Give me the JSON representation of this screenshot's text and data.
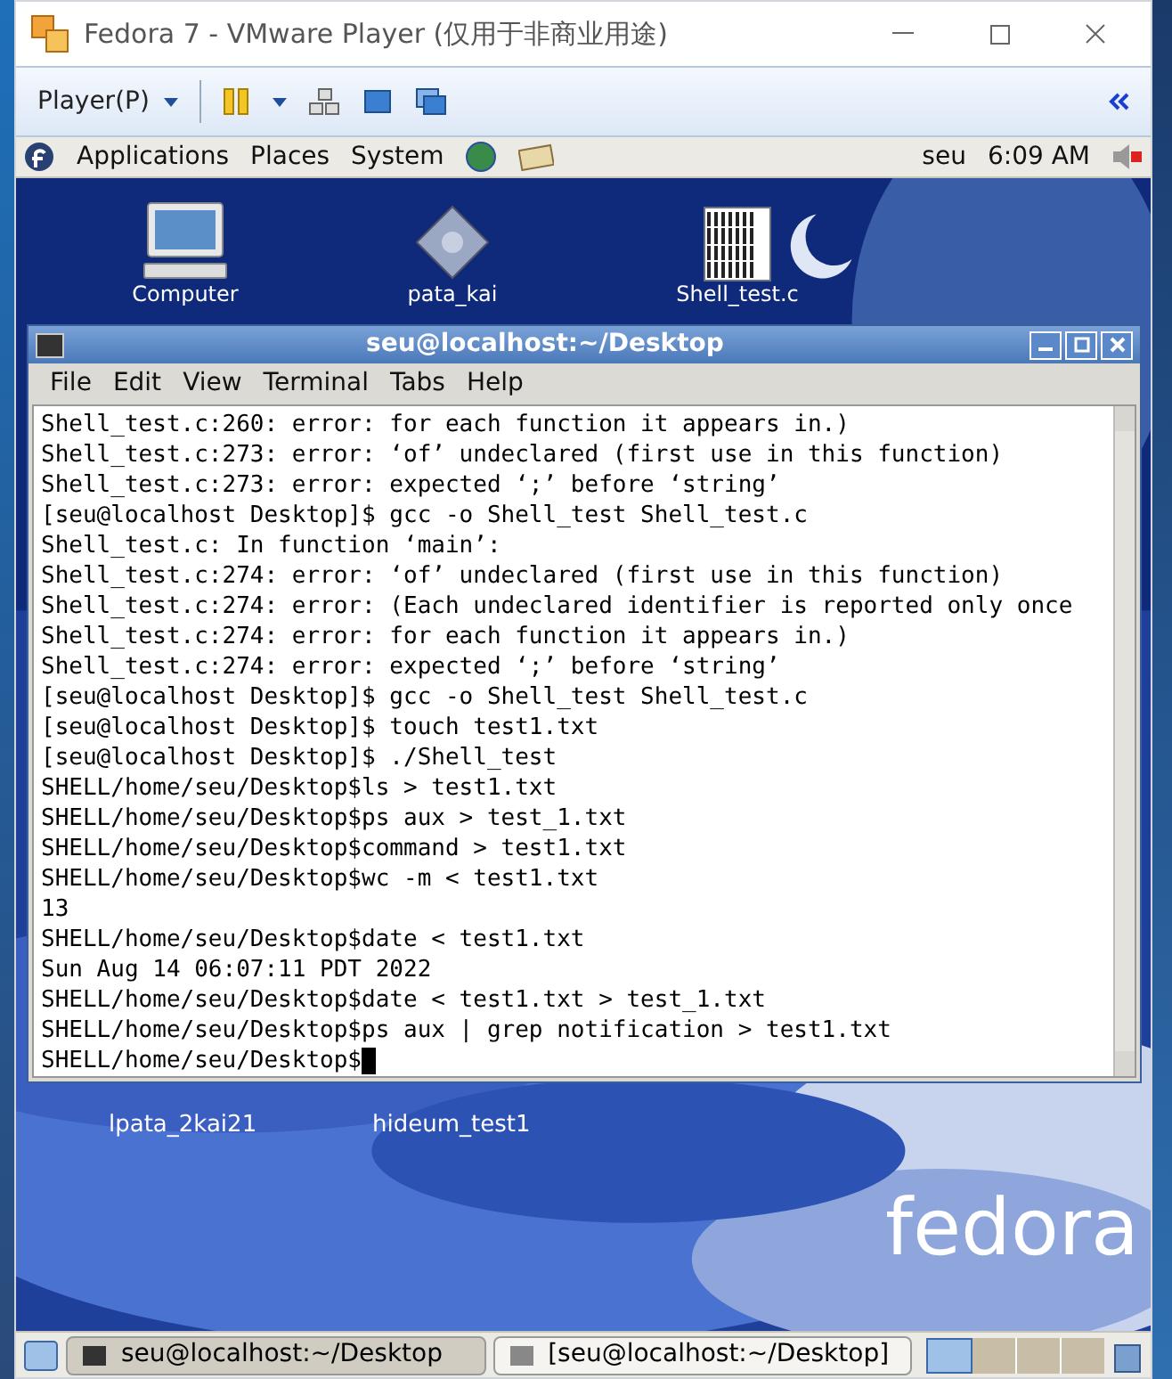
{
  "window": {
    "title": "Fedora 7 - VMware Player (仅用于非商业用途)"
  },
  "toolbar": {
    "player_menu": "Player(P)"
  },
  "top_panel": {
    "menus": [
      "Applications",
      "Places",
      "System"
    ],
    "user": "seu",
    "clock": "6:09 AM"
  },
  "desktop": {
    "icons": [
      {
        "label": "Computer",
        "kind": "computer"
      },
      {
        "label": "pata_kai",
        "kind": "package"
      },
      {
        "label": "Shell_test.c",
        "kind": "source"
      }
    ],
    "lower_labels": [
      "lpata_2kai21",
      "hideum_test1"
    ],
    "wallpaper_logo": "fedora"
  },
  "terminal": {
    "title": "seu@localhost:~/Desktop",
    "menus": [
      "File",
      "Edit",
      "View",
      "Terminal",
      "Tabs",
      "Help"
    ],
    "lines": [
      "Shell_test.c:260: error: for each function it appears in.)",
      "Shell_test.c:273: error: ‘of’ undeclared (first use in this function)",
      "Shell_test.c:273: error: expected ‘;’ before ‘string’",
      "[seu@localhost Desktop]$ gcc -o Shell_test Shell_test.c",
      "Shell_test.c: In function ‘main’:",
      "Shell_test.c:274: error: ‘of’ undeclared (first use in this function)",
      "Shell_test.c:274: error: (Each undeclared identifier is reported only once",
      "Shell_test.c:274: error: for each function it appears in.)",
      "Shell_test.c:274: error: expected ‘;’ before ‘string’",
      "[seu@localhost Desktop]$ gcc -o Shell_test Shell_test.c",
      "[seu@localhost Desktop]$ touch test1.txt",
      "[seu@localhost Desktop]$ ./Shell_test",
      "SHELL/home/seu/Desktop$ls > test1.txt",
      "SHELL/home/seu/Desktop$ps aux > test_1.txt",
      "SHELL/home/seu/Desktop$command > test1.txt",
      "SHELL/home/seu/Desktop$wc -m < test1.txt",
      "13",
      "SHELL/home/seu/Desktop$date < test1.txt",
      "Sun Aug 14 06:07:11 PDT 2022",
      "SHELL/home/seu/Desktop$date < test1.txt > test_1.txt",
      "SHELL/home/seu/Desktop$ps aux | grep notification > test1.txt",
      "SHELL/home/seu/Desktop$"
    ]
  },
  "taskbar": {
    "tasks": [
      {
        "label": "seu@localhost:~/Desktop",
        "selected": true
      },
      {
        "label": "[seu@localhost:~/Desktop]",
        "selected": false
      }
    ]
  }
}
